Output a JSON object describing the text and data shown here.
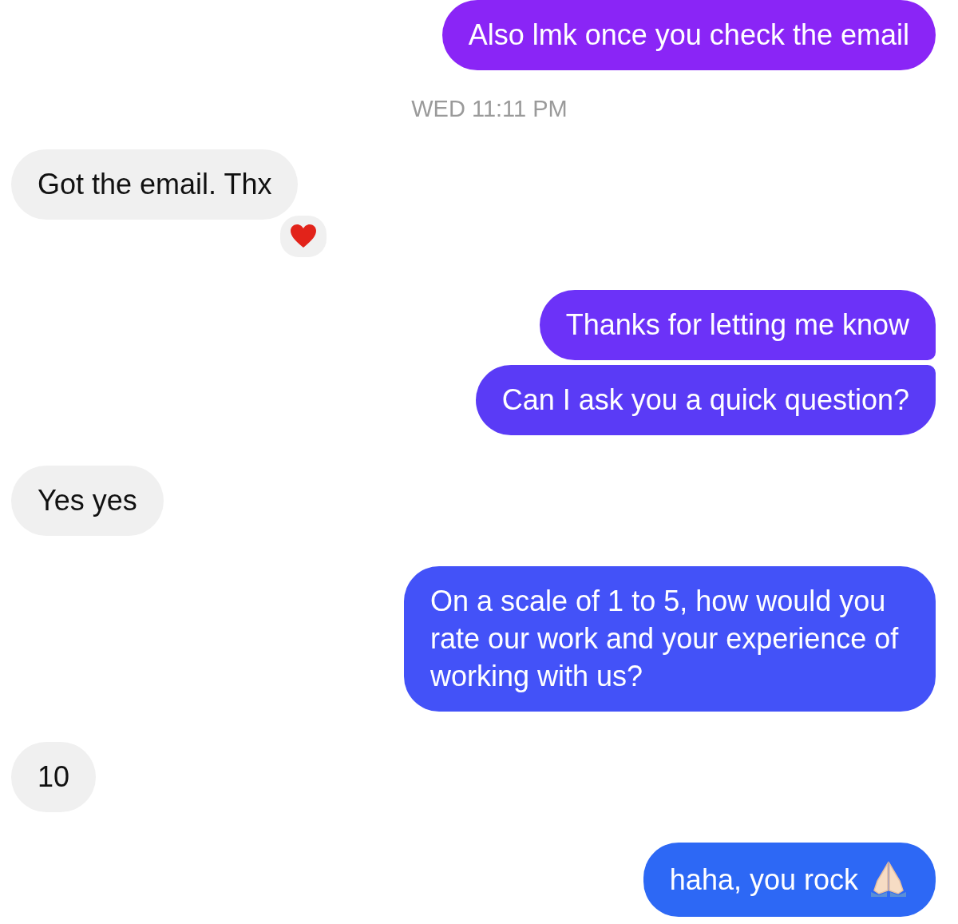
{
  "messages": [
    {
      "kind": "outgoing",
      "text": "Also lmk once you check the email",
      "color": "#8a25f6"
    },
    {
      "kind": "timestamp",
      "text": "WED 11:11 PM"
    },
    {
      "kind": "incoming",
      "text": "Got the email. Thx",
      "reacted": true
    },
    {
      "kind": "outgoing",
      "text": "Thanks for letting me know",
      "color": "#6c32f8"
    },
    {
      "kind": "outgoing",
      "text": "Can I ask you a quick question?",
      "color": "#5a3bf6"
    },
    {
      "kind": "incoming",
      "text": "Yes yes",
      "reacted": false
    },
    {
      "kind": "outgoing",
      "text": "On a scale of 1 to 5, how would you rate our work and your experience of working with us?",
      "color": "#4352f8"
    },
    {
      "kind": "incoming",
      "text": "10",
      "reacted": false
    },
    {
      "kind": "outgoing",
      "text": "haha, you rock",
      "color": "#2d68f5",
      "emoji": true
    }
  ]
}
